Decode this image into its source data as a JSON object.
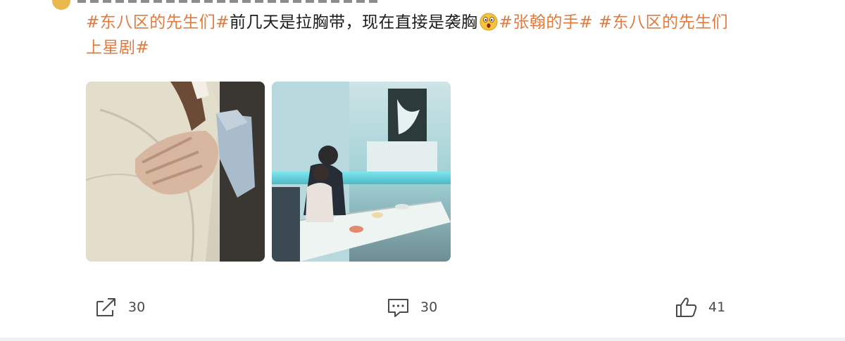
{
  "post": {
    "line1": [
      {
        "text": "#东八区的先生们#",
        "type": "hashtag"
      },
      {
        "text": "前几天是拉胸带，现在直接是袭胸",
        "type": "text"
      },
      {
        "type": "emoji",
        "icon": "shocked-face-emoji"
      },
      {
        "text": "#张翰的手#",
        "type": "hashtag"
      },
      {
        "text": " ",
        "type": "text"
      },
      {
        "text": "#东八区的先生们",
        "type": "hashtag"
      }
    ],
    "line2": [
      {
        "text": "上星剧#",
        "type": "hashtag"
      }
    ]
  },
  "images": [
    {
      "name": "post-image-1",
      "icon": "photo-closeup-hand-shirt"
    },
    {
      "name": "post-image-2",
      "icon": "photo-couple-at-table"
    }
  ],
  "actions": {
    "share_count": "30",
    "comment_count": "30",
    "like_count": "41"
  },
  "colors": {
    "hashtag": "#e07a3f",
    "text": "#1c1c1c",
    "icon": "#4a4a4a"
  }
}
